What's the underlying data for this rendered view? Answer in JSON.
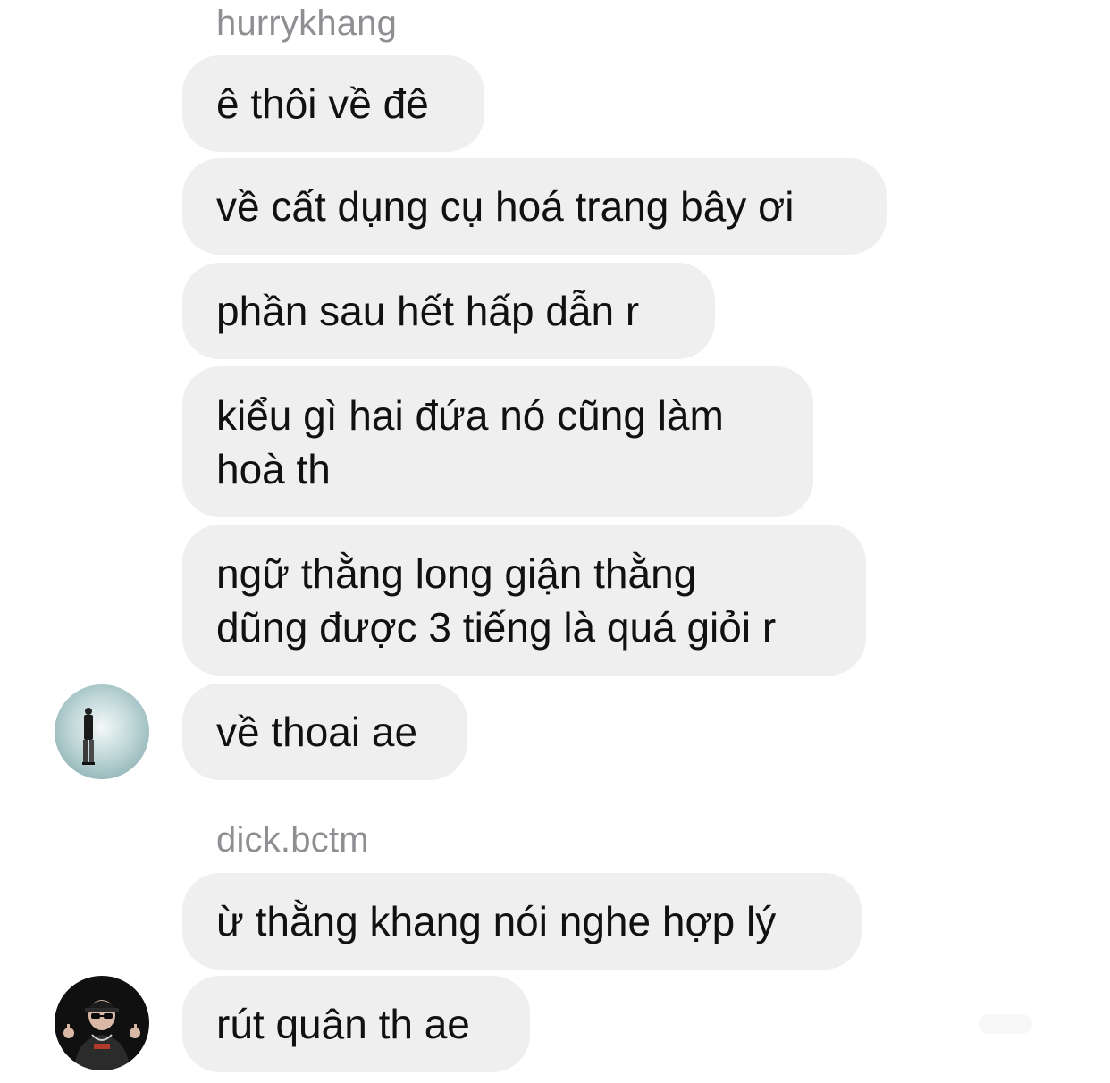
{
  "thread": {
    "groups": [
      {
        "sender": "hurrykhang",
        "avatar_icon": "user-avatar-icon",
        "messages": [
          "ê thôi về đê",
          "về cất dụng cụ hoá trang bây ơi",
          "phần sau hết hấp dẫn r",
          [
            "kiểu gì hai đứa nó cũng làm",
            "hoà th"
          ],
          [
            "ngữ thằng long giận thằng",
            "dũng được 3 tiếng là quá giỏi r"
          ],
          "về thoai ae"
        ]
      },
      {
        "sender": "dick.bctm",
        "avatar_icon": "user-avatar-icon",
        "messages": [
          "ừ thằng khang nói nghe hợp lý",
          "rút quân th ae"
        ]
      }
    ]
  },
  "colors": {
    "bubble_bg": "#efefef",
    "sender_text": "#8e8e93",
    "message_text": "#111111"
  }
}
